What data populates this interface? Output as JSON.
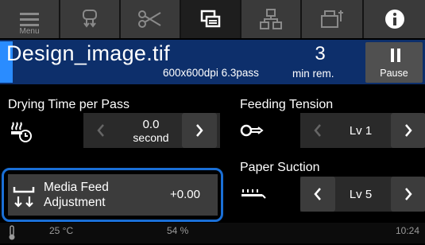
{
  "toolbar": {
    "menu_label": "Menu",
    "icons": [
      "menu-icon",
      "media-icon",
      "cutter-icon",
      "job-list-icon",
      "network-icon",
      "printer-settings-icon",
      "info-icon"
    ]
  },
  "job": {
    "filename": "Design_image.tif",
    "resolution": "600x600dpi 6.3pass",
    "remaining_count": "3",
    "remaining_unit": "min rem.",
    "pause_label": "Pause"
  },
  "drying": {
    "label": "Drying Time per Pass",
    "value": "0.0",
    "unit": "second"
  },
  "feeding": {
    "label": "Feeding Tension",
    "value": "Lv 1"
  },
  "suction": {
    "label": "Paper Suction",
    "value": "Lv 5"
  },
  "media_feed": {
    "label_line1": "Media Feed",
    "label_line2": "Adjustment",
    "value": "+0.00"
  },
  "status": {
    "temperature": "25 °C",
    "humidity": "54 %",
    "time": "10:24"
  },
  "colors": {
    "accent": "#1a6fd6",
    "job_bar": "#0d2f6b",
    "progress": "#2a8cff"
  }
}
